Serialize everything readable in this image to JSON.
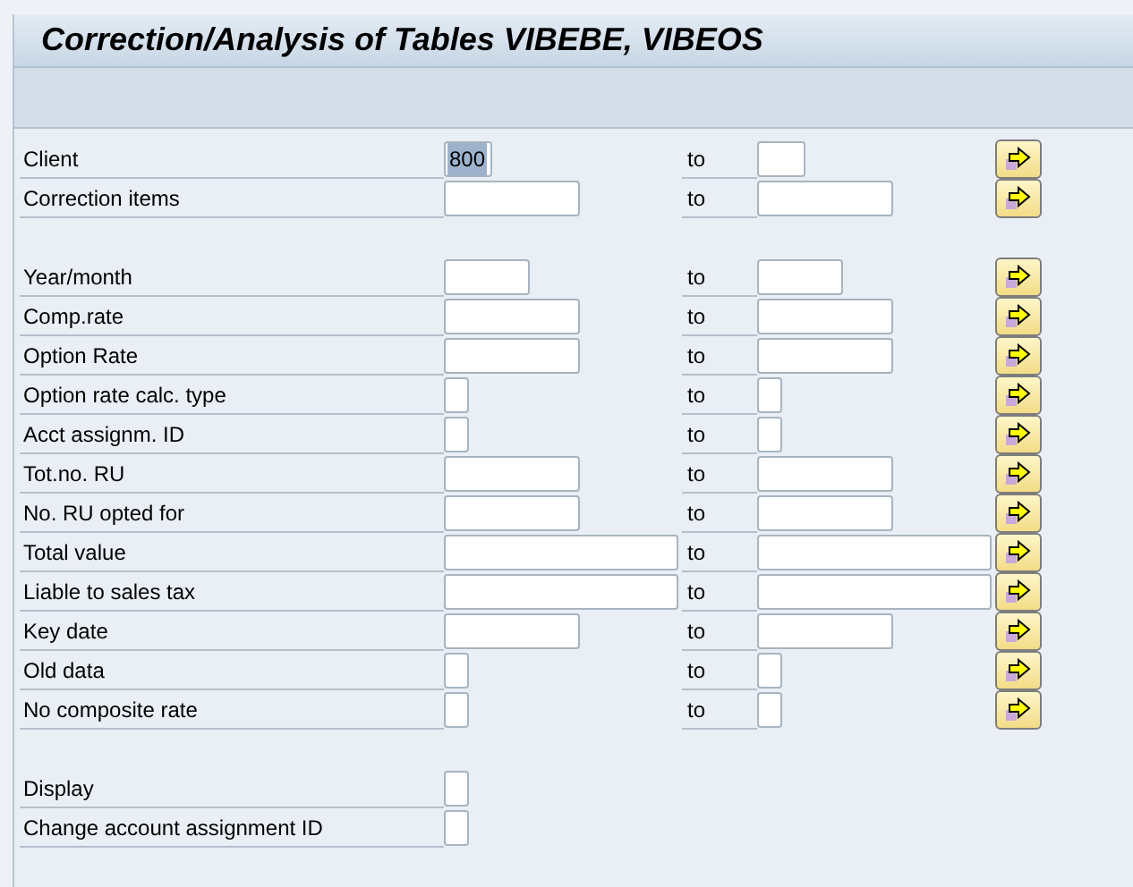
{
  "title": "Correction/Analysis of Tables VIBEBE, VIBEOS",
  "groups": [
    {
      "rows": [
        {
          "label": "Client",
          "from": {
            "value": "800",
            "kind": "short",
            "highlighted": true
          },
          "to_label": "to",
          "to": {
            "kind": "short"
          }
        },
        {
          "label": "Correction items",
          "from": {
            "kind": "medium"
          },
          "to_label": "to",
          "to": {
            "kind": "medium"
          }
        }
      ]
    },
    {
      "rows": [
        {
          "label": "Year/month",
          "from": {
            "kind": "date"
          },
          "to_label": "to",
          "to": {
            "kind": "date"
          }
        },
        {
          "label": "Comp.rate",
          "from": {
            "kind": "medium"
          },
          "to_label": "to",
          "to": {
            "kind": "medium"
          }
        },
        {
          "label": "Option Rate",
          "from": {
            "kind": "medium"
          },
          "to_label": "to",
          "to": {
            "kind": "medium"
          }
        },
        {
          "label": "Option rate calc. type",
          "from": {
            "kind": "char"
          },
          "to_label": "to",
          "to": {
            "kind": "char"
          }
        },
        {
          "label": "Acct assignm. ID",
          "from": {
            "kind": "char"
          },
          "to_label": "to",
          "to": {
            "kind": "char"
          }
        },
        {
          "label": "Tot.no. RU",
          "from": {
            "kind": "medium"
          },
          "to_label": "to",
          "to": {
            "kind": "medium"
          }
        },
        {
          "label": "No. RU opted for",
          "from": {
            "kind": "medium"
          },
          "to_label": "to",
          "to": {
            "kind": "medium"
          }
        },
        {
          "label": "Total value",
          "from": {
            "kind": "long"
          },
          "to_label": "to",
          "to": {
            "kind": "long"
          }
        },
        {
          "label": "Liable to sales tax",
          "from": {
            "kind": "long"
          },
          "to_label": "to",
          "to": {
            "kind": "long"
          }
        },
        {
          "label": "Key date",
          "from": {
            "kind": "medium"
          },
          "to_label": "to",
          "to": {
            "kind": "medium"
          }
        },
        {
          "label": "Old data",
          "from": {
            "kind": "char"
          },
          "to_label": "to",
          "to": {
            "kind": "char"
          }
        },
        {
          "label": "No composite rate",
          "from": {
            "kind": "char"
          },
          "to_label": "to",
          "to": {
            "kind": "char"
          }
        }
      ]
    },
    {
      "rows": [
        {
          "label": "Display",
          "from": {
            "kind": "char"
          }
        },
        {
          "label": "Change account assignment ID",
          "from": {
            "kind": "char"
          }
        }
      ]
    }
  ]
}
